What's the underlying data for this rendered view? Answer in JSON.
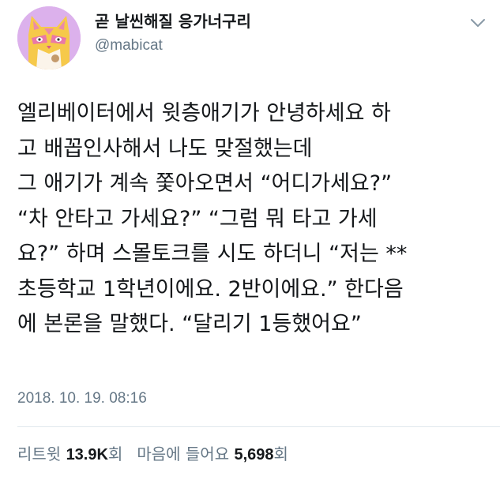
{
  "author": {
    "display_name": "곧 날씬해질 응가너구리",
    "handle": "@mabicat",
    "avatar_icon": "pink-cat-avatar-icon"
  },
  "menu": {
    "icon": "chevron-down-icon"
  },
  "tweet": {
    "lines": [
      "엘리베이터에서 윗층애기가 안녕하세요 하",
      "고 배꼽인사해서 나도 맞절했는데",
      "그 애기가 계속 쫓아오면서 “어디가세요?”",
      "“차 안타고 가세요?” “그럼 뭐 타고 가세",
      "요?” 하며 스몰토크를 시도 하더니 “저는 **",
      "초등학교 1학년이에요. 2반이에요.” 한다음",
      "에 본론을 말했다. “달리기 1등했어요”"
    ],
    "timestamp": "2018. 10. 19. 08:16"
  },
  "stats": {
    "retweets_label": "리트윗",
    "retweets_count": "13.9K",
    "retweets_unit": "회",
    "likes_label": "마음에 들어요",
    "likes_count": "5,698",
    "likes_unit": "회"
  },
  "colors": {
    "text": "#14171a",
    "secondary": "#657786",
    "avatar_bg": "#dcb1ec",
    "cat_fur": "#f4c542",
    "divider": "#e1e8ed"
  }
}
